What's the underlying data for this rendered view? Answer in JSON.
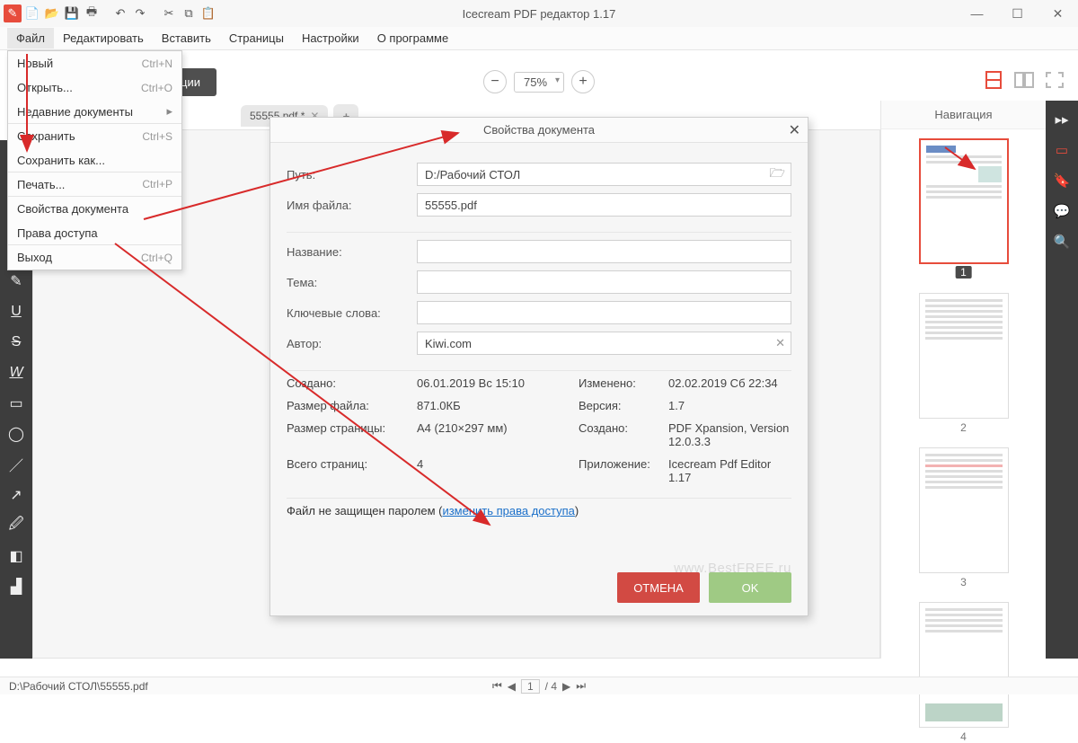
{
  "title": "Icecream PDF редактор 1.17",
  "menubar": [
    "Файл",
    "Редактировать",
    "Вставить",
    "Страницы",
    "Настройки",
    "О программе"
  ],
  "mode_tabs": {
    "annotate": "Аннотации"
  },
  "zoom": "75%",
  "doc_tab": "55555.pdf *",
  "nav_title": "Навигация",
  "file_menu": {
    "new": {
      "label": "Новый",
      "shortcut": "Ctrl+N"
    },
    "open": {
      "label": "Открыть...",
      "shortcut": "Ctrl+O"
    },
    "recent": {
      "label": "Недавние документы"
    },
    "save": {
      "label": "Сохранить",
      "shortcut": "Ctrl+S"
    },
    "saveas": {
      "label": "Сохранить как..."
    },
    "print": {
      "label": "Печать...",
      "shortcut": "Ctrl+P"
    },
    "props": {
      "label": "Свойства документа"
    },
    "perm": {
      "label": "Права доступа"
    },
    "exit": {
      "label": "Выход",
      "shortcut": "Ctrl+Q"
    }
  },
  "dialog": {
    "title": "Свойства документа",
    "labels": {
      "path": "Путь:",
      "filename": "Имя файла:",
      "name": "Название:",
      "subject": "Тема:",
      "keywords": "Ключевые слова:",
      "author": "Автор:",
      "created": "Создано:",
      "modified": "Изменено:",
      "filesize": "Размер файла:",
      "version": "Версия:",
      "pagesize": "Размер страницы:",
      "creator": "Создано:",
      "pages": "Всего страниц:",
      "app": "Приложение:"
    },
    "values": {
      "path": "D:/Рабочий СТОЛ",
      "filename": "55555.pdf",
      "name": "",
      "subject": "",
      "keywords": "",
      "author": "Kiwi.com",
      "created": "06.01.2019 Вс 15:10",
      "modified": "02.02.2019 Сб 22:34",
      "filesize": "871.0КБ",
      "version": "1.7",
      "pagesize": "A4 (210×297 мм)",
      "creator": "PDF Xpansion, Version 12.0.3.3",
      "pages": "4",
      "app": "Icecream Pdf Editor 1.17"
    },
    "protection_prefix": "Файл не защищен паролем (",
    "protection_link": "изменить права доступа",
    "protection_suffix": ")",
    "cancel": "ОТМЕНА",
    "ok": "OK"
  },
  "thumbs": [
    "1",
    "2",
    "3",
    "4"
  ],
  "status_path": "D:\\Рабочий СТОЛ\\55555.pdf",
  "pager": {
    "current": "1",
    "total": "/ 4"
  },
  "watermark": "www.BestFREE.ru"
}
